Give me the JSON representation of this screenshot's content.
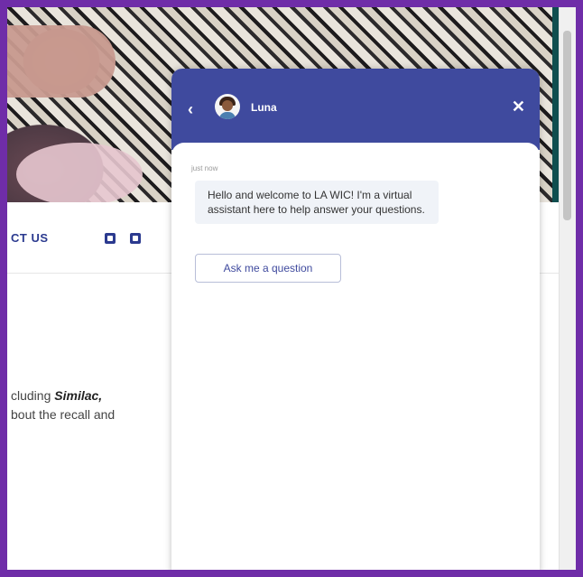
{
  "page": {
    "nav": {
      "contact_label": "CT US",
      "social": [
        "facebook-icon",
        "twitter-icon"
      ]
    },
    "article": {
      "line1_prefix": "cluding ",
      "line1_bold": "Similac,",
      "line2": "bout the recall and"
    }
  },
  "chat": {
    "agent_name": "Luna",
    "back_icon": "‹",
    "close_icon": "✕",
    "timestamp": "just now",
    "welcome_message": "Hello and welcome to LA WIC! I'm a virtual assistant here to help answer your questions.",
    "ask_button_label": "Ask me a question"
  },
  "colors": {
    "frame": "#6f2da8",
    "chat_header": "#3f4a9e",
    "nav_text": "#2b3a8f",
    "hero_teal": "#0f4e4f"
  }
}
